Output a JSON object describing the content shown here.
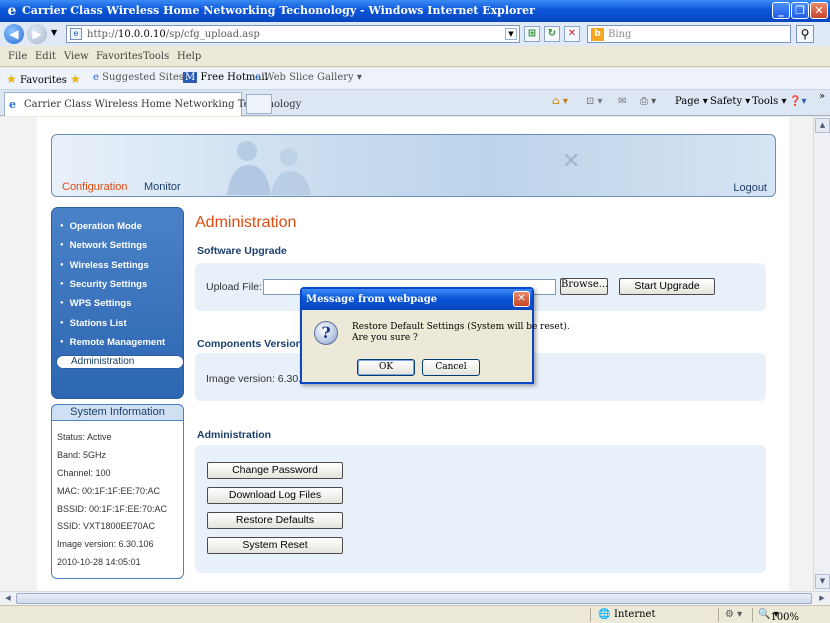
{
  "window": {
    "title": "Carrier Class Wireless Home Networking Techonology - Windows Internet Explorer",
    "minimize": "_",
    "maximize": "❐",
    "close": "✕"
  },
  "address": {
    "url_prefix": "http://",
    "url_host": "10.0.0.10",
    "url_path": "/sp/cfg_upload.asp",
    "search_placeholder": "Bing"
  },
  "menu": [
    "File",
    "Edit",
    "View",
    "Favorites",
    "Tools",
    "Help"
  ],
  "favorites_bar": {
    "favorites": "Favorites",
    "suggested_sites": "Suggested Sites",
    "free_hotmail": "Free Hotmail",
    "web_slice_gallery": "Web Slice Gallery"
  },
  "tab": {
    "label": "Carrier Class Wireless Home Networking Techonology"
  },
  "command_bar": {
    "page": "Page",
    "safety": "Safety",
    "tools": "Tools",
    "more": "»"
  },
  "header_nav": {
    "configuration": "Configuration",
    "monitor": "Monitor",
    "logout": "Logout"
  },
  "sidebar": {
    "items": [
      {
        "label": "Operation Mode"
      },
      {
        "label": "Network Settings"
      },
      {
        "label": "Wireless Settings"
      },
      {
        "label": "Security Settings"
      },
      {
        "label": "WPS Settings"
      },
      {
        "label": "Stations List"
      },
      {
        "label": "Remote Management"
      }
    ],
    "active_item": "Administration"
  },
  "system_info": {
    "title": "System Information",
    "rows": [
      "Status: Active",
      "Band: 5GHz",
      "Channel: 100",
      "MAC: 00:1F:1F:EE:70:AC",
      "BSSID: 00:1F:1F:EE:70:AC",
      "SSID: VXT1800EE70AC",
      "Image version: 6.30.106",
      "2010-10-28 14:05:01"
    ]
  },
  "main": {
    "title": "Administration",
    "software_upgrade": {
      "title": "Software Upgrade",
      "upload_label": "Upload File:",
      "browse": "Browse...",
      "start_upgrade": "Start Upgrade"
    },
    "components": {
      "title": "Components Versions",
      "image_version": "Image version: 6.30.1"
    },
    "administration": {
      "title": "Administration",
      "buttons": [
        "Change Password",
        "Download Log Files",
        "Restore Defaults",
        "System Reset"
      ]
    }
  },
  "dialog": {
    "title": "Message from webpage",
    "line1": "Restore Default Settings (System will be reset).",
    "line2": "Are you sure ?",
    "ok": "OK",
    "cancel": "Cancel"
  },
  "statusbar": {
    "zone": "Internet",
    "zoom": "100%"
  },
  "colors": {
    "accent_orange": "#e04a10",
    "nav_blue": "#1b3f6b",
    "menu_blue": "#2d66b2",
    "xp_titlebar": "#0a55d8"
  }
}
